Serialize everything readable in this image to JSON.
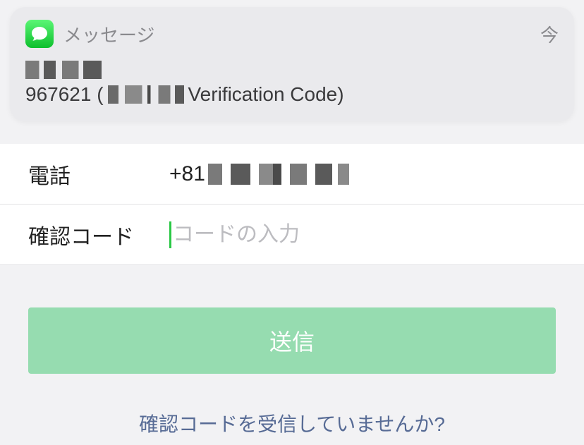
{
  "notification": {
    "app_name": "メッセージ",
    "time": "今",
    "body_prefix": "967621 (",
    "body_suffix": " Verification Code)"
  },
  "form": {
    "phone_label": "電話",
    "phone_prefix": "+81",
    "code_label": "確認コード",
    "code_placeholder": "コードの入力",
    "code_value": ""
  },
  "submit_label": "送信",
  "resend_text": "確認コードを受信していませんか?"
}
